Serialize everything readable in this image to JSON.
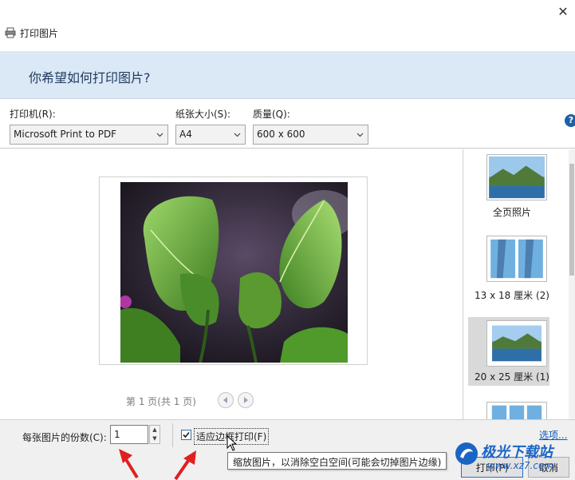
{
  "window": {
    "title": "打印图片",
    "close_glyph": "✕"
  },
  "header": {
    "question": "你希望如何打印图片?"
  },
  "printer": {
    "label": "打印机(R):",
    "value": "Microsoft Print to PDF"
  },
  "paper_size": {
    "label": "纸张大小(S):",
    "value": "A4"
  },
  "quality": {
    "label": "质量(Q):",
    "value": "600 x 600"
  },
  "help": {
    "glyph": "?"
  },
  "preview": {
    "pager": "第 1 页(共 1 页)"
  },
  "layouts": [
    {
      "label": "全页照片",
      "selected": false
    },
    {
      "label": "13 x 18 厘米 (2)",
      "selected": false
    },
    {
      "label": "20 x 25 厘米 (1)",
      "selected": true
    },
    {
      "label": "",
      "selected": false
    }
  ],
  "copies": {
    "label": "每张图片的份数(C):",
    "value": "1"
  },
  "fit_to_frame": {
    "label": "适应边框打印(F)",
    "checked": true
  },
  "tooltip": {
    "text": "缩放图片，以消除空白空间(可能会切掉图片边缘)"
  },
  "options_link": "选项...",
  "buttons": {
    "print": "打印(P)",
    "cancel": "取消"
  },
  "watermark": {
    "text": "极光下载站",
    "url": "www.xz7.com"
  },
  "colors": {
    "header_band": "#dbe8f5",
    "selected_layout": "#d9d9d9",
    "annotation_arrow": "#e02020",
    "link": "#0b57b7"
  }
}
